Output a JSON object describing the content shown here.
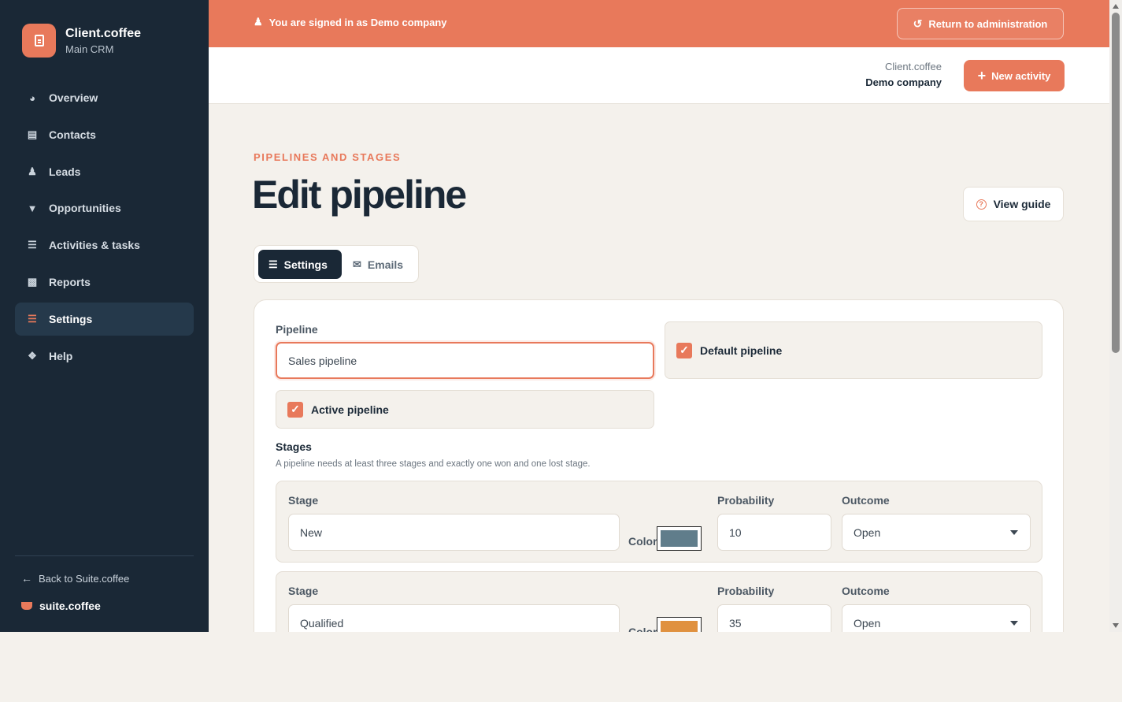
{
  "banner": {
    "signed_in_text": "You are signed in as Demo company",
    "return_label": "Return to administration",
    "accent": "#e8795b"
  },
  "brand": {
    "name": "Client.coffee",
    "subtitle": "Main CRM"
  },
  "sidebar": {
    "items": [
      {
        "label": "Overview",
        "icon": "pie-chart-icon"
      },
      {
        "label": "Contacts",
        "icon": "contact-card-icon"
      },
      {
        "label": "Leads",
        "icon": "user-plus-icon"
      },
      {
        "label": "Opportunities",
        "icon": "funnel-icon"
      },
      {
        "label": "Activities & tasks",
        "icon": "list-icon"
      },
      {
        "label": "Reports",
        "icon": "bar-chart-icon"
      },
      {
        "label": "Settings",
        "icon": "sliders-icon",
        "active": true
      },
      {
        "label": "Help",
        "icon": "help-circle-icon"
      }
    ],
    "back_label": "Back to Suite.coffee",
    "suite_label": "suite.coffee"
  },
  "header": {
    "app_name": "Client.coffee",
    "company": "Demo company",
    "new_activity_label": "New activity"
  },
  "page": {
    "eyebrow": "PIPELINES AND STAGES",
    "title": "Edit pipeline",
    "guide_label": "View guide"
  },
  "tabs": [
    {
      "label": "Settings",
      "icon": "sliders-icon",
      "active": true
    },
    {
      "label": "Emails",
      "icon": "envelope-icon",
      "active": false
    }
  ],
  "form": {
    "pipeline_label": "Pipeline",
    "pipeline_value": "Sales pipeline",
    "default_label": "Default pipeline",
    "default_checked": true,
    "active_label": "Active pipeline",
    "active_checked": true,
    "stages_title": "Stages",
    "stages_help": "A pipeline needs at least three stages and exactly one won and one lost stage.",
    "stage_label": "Stage",
    "color_label": "Color",
    "probability_label": "Probability",
    "outcome_label": "Outcome",
    "stages": [
      {
        "name": "New",
        "color": "#607d8b",
        "probability": "10",
        "outcome": "Open"
      },
      {
        "name": "Qualified",
        "color": "#e0913f",
        "probability": "35",
        "outcome": "Open"
      }
    ]
  }
}
